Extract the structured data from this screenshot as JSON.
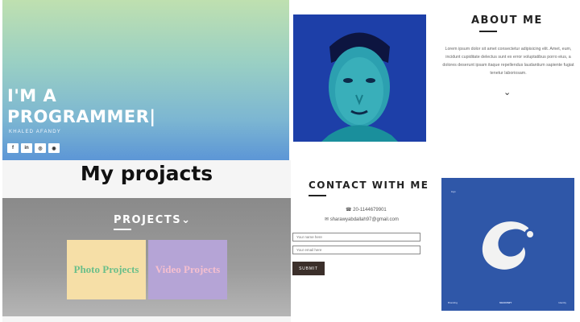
{
  "hero": {
    "title_line1": "I'M A",
    "title_line2": "PROGRAMMER|",
    "subtitle": "KHALED AFANDY",
    "social_icons": [
      "facebook-icon",
      "linkedin-icon",
      "instagram-icon",
      "github-icon"
    ],
    "social_glyphs": [
      "f",
      "in",
      "◎",
      "◉"
    ]
  },
  "about": {
    "title": "ABOUT ME",
    "body": "Lorem ipsum dolor sit amet consectetur adipisicing elit. Amet, eum, incidunt cupiditate delectus sunt ex error voluptatibus porro eius, a dolores deserunt ipsam itaque repellendus laudantium sapiente fugiat tenetur laboriosam.",
    "chevron": "⌄",
    "portrait_image": "portrait-photo"
  },
  "projects": {
    "heading": "My projacts",
    "section_title": "PROJECTS",
    "section_chevron": "⌄",
    "cards": [
      {
        "label": "Photo Projects"
      },
      {
        "label": "Video Projects"
      }
    ]
  },
  "contact": {
    "title": "CONTACT WITH ME",
    "phone": "☎ 20-1144679901",
    "email": "✉ sharawyabdallah97@gmail.com",
    "name_placeholder": "Your name here",
    "email_placeholder": "Your email here",
    "submit_label": "SUBMIT",
    "brand_card": {
      "corner_text": "logo",
      "footer_left": "Branding",
      "footer_center": "SHARAWY",
      "footer_right": "Identity"
    }
  },
  "colors": {
    "hero_gradient_top": "#bfe0b0",
    "hero_gradient_bottom": "#5c96d6",
    "brand_blue": "#2f57a8",
    "photo_card": "#f6dfa7",
    "video_card": "#b5a4d6"
  }
}
